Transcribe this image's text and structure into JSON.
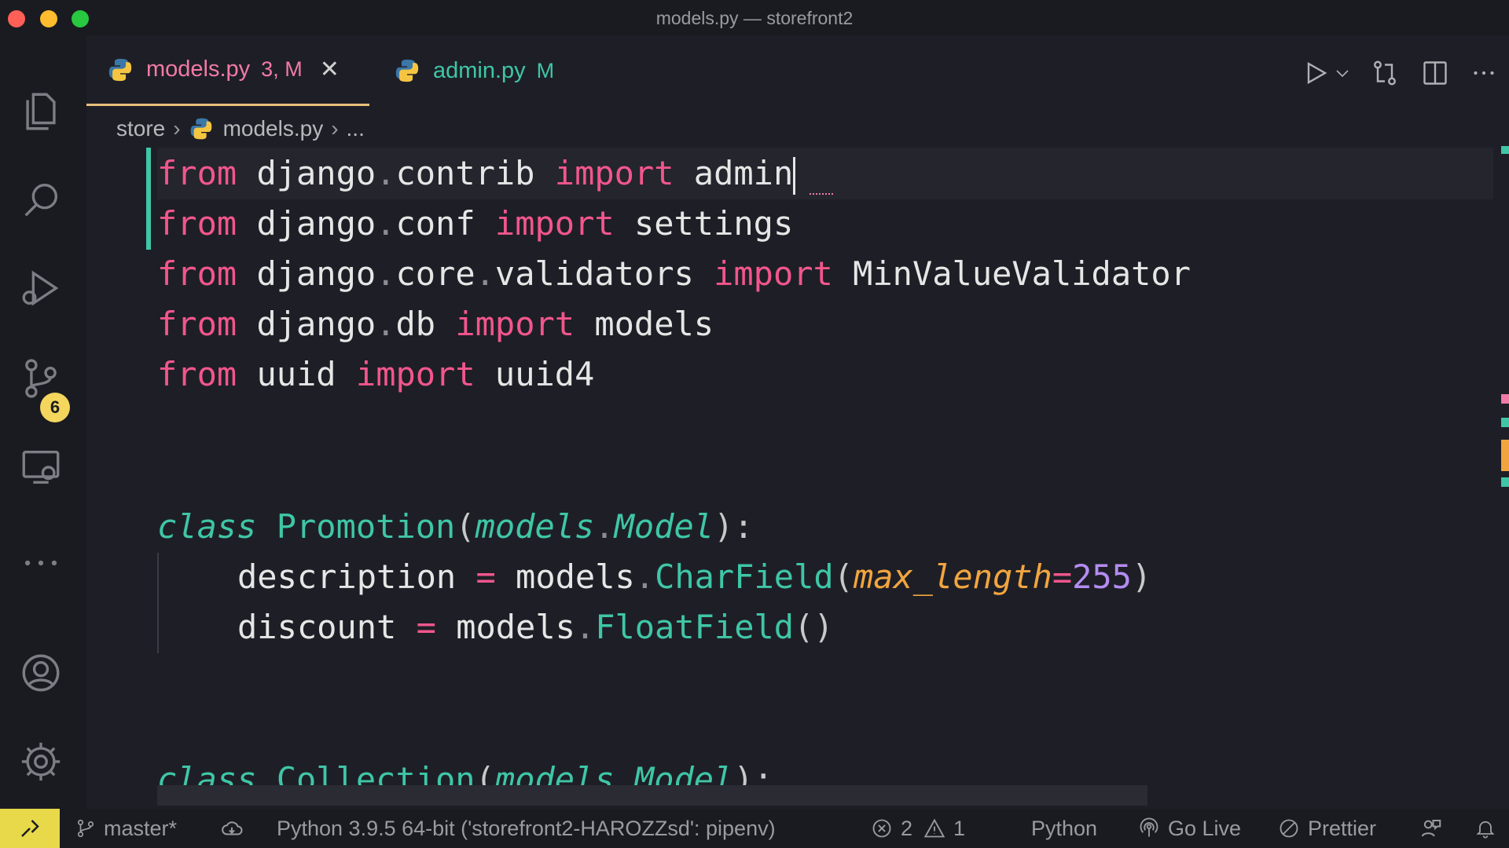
{
  "window": {
    "title": "models.py — storefront2"
  },
  "activity_bar": {
    "source_control_badge": "6",
    "icons": [
      "explorer-icon",
      "search-icon",
      "run-debug-icon",
      "source-control-icon",
      "remote-explorer-icon",
      "more-icon",
      "accounts-icon",
      "settings-gear-icon"
    ]
  },
  "tabs": [
    {
      "name": "models.py",
      "status": "3, M",
      "active": true
    },
    {
      "name": "admin.py",
      "status": "M",
      "active": false
    }
  ],
  "breadcrumb": {
    "folder": "store",
    "file": "models.py",
    "more": "..."
  },
  "code": {
    "line1": {
      "kw1": "from",
      "mod": "django",
      "sub": "contrib",
      "kw2": "import",
      "name": "admin"
    },
    "line2": {
      "kw1": "from",
      "mod": "django",
      "sub": "conf",
      "kw2": "import",
      "name": "settings"
    },
    "line3": {
      "kw1": "from",
      "mod": "django",
      "sub1": "core",
      "sub2": "validators",
      "kw2": "import",
      "name": "MinValueValidator"
    },
    "line4": {
      "kw1": "from",
      "mod": "django",
      "sub": "db",
      "kw2": "import",
      "name": "models"
    },
    "line5": {
      "kw1": "from",
      "mod": "uuid",
      "kw2": "import",
      "name": "uuid4"
    },
    "class1": {
      "kw": "class",
      "name": "Promotion",
      "base_mod": "models",
      "base": "Model"
    },
    "field1": {
      "name": "description",
      "op": "=",
      "mod": "models",
      "fn": "CharField",
      "param": "max_length",
      "value": "255"
    },
    "field2": {
      "name": "discount",
      "op": "=",
      "mod": "models",
      "fn": "FloatField"
    },
    "class2": {
      "kw": "class",
      "name": "Collection",
      "base_mod": "models",
      "base": "Model"
    }
  },
  "status_bar": {
    "branch": "master*",
    "interpreter": "Python 3.9.5 64-bit ('storefront2-HAROZZsd': pipenv)",
    "errors": "2",
    "warnings": "1",
    "language": "Python",
    "go_live": "Go Live",
    "prettier": "Prettier"
  },
  "colors": {
    "keyword": "#f2568c",
    "type": "#3fc6a7",
    "param": "#f2a53f",
    "number": "#b48cf2",
    "modified": "#3fc6a7",
    "badge": "#f3d65b",
    "remote": "#e7d94a"
  }
}
